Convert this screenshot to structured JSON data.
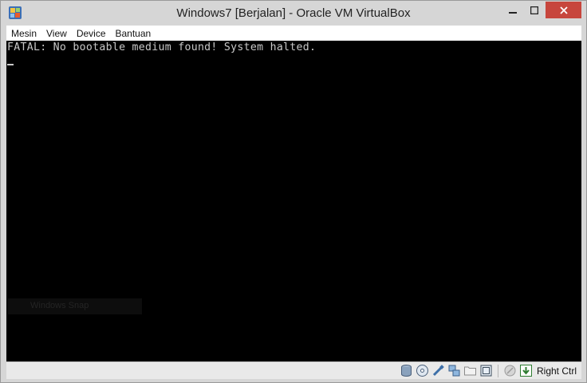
{
  "window": {
    "title": "Windows7 [Berjalan] - Oracle VM VirtualBox",
    "app_icon": "virtualbox-icon"
  },
  "menu": [
    "Mesin",
    "View",
    "Device",
    "Bantuan"
  ],
  "screen": {
    "line1": "FATAL: No bootable medium found! System halted.",
    "ghost_text": "Windows Snap"
  },
  "statusbar": {
    "icons": [
      "hard-disk-icon",
      "optical-drive-icon",
      "usb-icon",
      "network-icon",
      "shared-folders-icon",
      "capture-icon",
      "mouse-integration-icon",
      "host-key-icon"
    ],
    "host_key": "Right Ctrl"
  },
  "colors": {
    "close_button": "#c7463d",
    "chrome": "#d6d6d6",
    "screen_bg": "#000000",
    "console_text": "#c8c8c8"
  }
}
